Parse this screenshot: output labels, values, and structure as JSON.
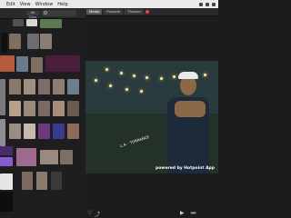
{
  "menubar": {
    "apple": "",
    "items": [
      "Edit",
      "View",
      "Window",
      "Help"
    ]
  },
  "left_toolbar": {
    "filter_label": "All Clips",
    "search_placeholder": ""
  },
  "right_toolbar": {
    "tabs": [
      "Media",
      "Projects",
      "Theater"
    ]
  },
  "preview": {
    "overlay_text": "L.A. · TORRANCE",
    "watermark": "powered by Hotpoint App"
  },
  "bottom_bar": {
    "icons": [
      "heart-icon",
      "share-icon",
      "play-icon",
      "skip-icon"
    ]
  },
  "colors": {
    "sidebar_bg": "#1e1e20",
    "toolbar_bg": "#2a2a2c",
    "menubar_bg": "#e9e9ea"
  }
}
